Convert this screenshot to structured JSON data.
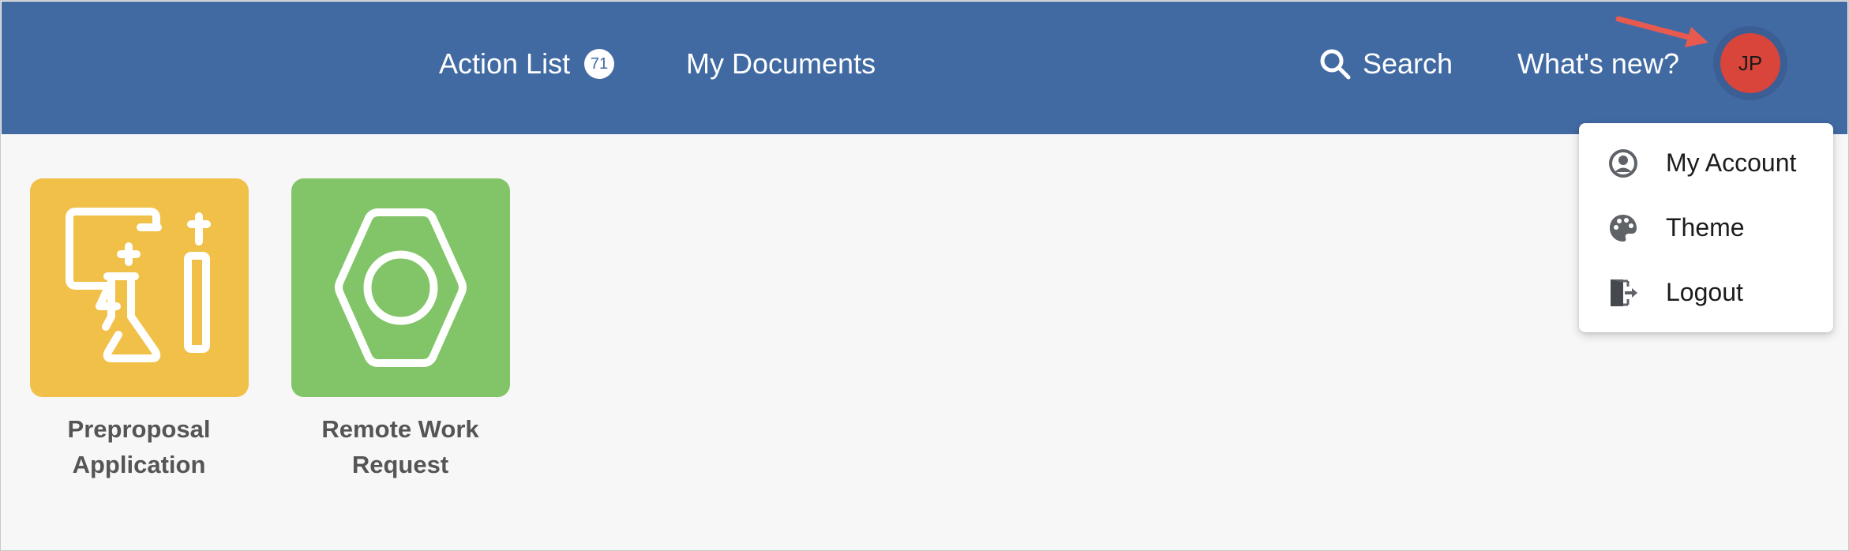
{
  "header": {
    "nav": {
      "action_list_label": "Action List",
      "action_list_count": "71",
      "my_documents_label": "My Documents",
      "search_label": "Search",
      "whats_new_label": "What's new?"
    },
    "user": {
      "initials": "JP",
      "avatar_color": "#d9443b"
    },
    "background_color": "#416aa3"
  },
  "user_menu": {
    "items": [
      {
        "label": "My Account",
        "icon": "account-circle-icon"
      },
      {
        "label": "Theme",
        "icon": "palette-icon"
      },
      {
        "label": "Logout",
        "icon": "logout-door-icon"
      }
    ]
  },
  "tiles": [
    {
      "label": "Preproposal\nApplication",
      "icon": "science-flask-icon",
      "color": "#f0c048"
    },
    {
      "label": "Remote Work\nRequest",
      "icon": "hexagon-ring-icon",
      "color": "#82c468"
    }
  ],
  "annotation": {
    "arrow_color": "#e85a4f"
  }
}
